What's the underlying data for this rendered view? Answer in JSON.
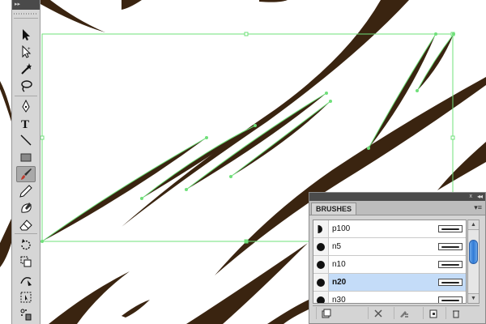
{
  "toolbar": {
    "header_glyph": "▸▸",
    "tools": [
      {
        "name": "selection-tool",
        "icon": "arrow-icon"
      },
      {
        "name": "direct-selection-tool",
        "icon": "hollow-arrow-icon"
      },
      {
        "name": "magic-wand-tool",
        "icon": "magic-wand-icon"
      },
      {
        "name": "lasso-tool",
        "icon": "lasso-icon"
      },
      {
        "name": "pen-tool",
        "icon": "pen-icon"
      },
      {
        "name": "type-tool",
        "icon": "type-icon",
        "glyph": "T"
      },
      {
        "name": "line-tool",
        "icon": "line-icon"
      },
      {
        "name": "rectangle-tool",
        "icon": "rectangle-icon"
      },
      {
        "name": "paintbrush-tool",
        "icon": "paintbrush-icon",
        "active": true
      },
      {
        "name": "pencil-tool",
        "icon": "pencil-icon"
      },
      {
        "name": "blob-brush-tool",
        "icon": "blob-brush-icon"
      },
      {
        "name": "eraser-tool",
        "icon": "eraser-icon"
      },
      {
        "name": "rotate-tool",
        "icon": "rotate-icon"
      },
      {
        "name": "scale-tool",
        "icon": "scale-icon"
      },
      {
        "name": "warp-tool",
        "icon": "warp-icon"
      },
      {
        "name": "free-transform-tool",
        "icon": "free-transform-icon"
      },
      {
        "name": "symbol-sprayer-tool",
        "icon": "symbol-sprayer-icon"
      }
    ]
  },
  "brushes_panel": {
    "tab_label": "BRUSHES",
    "collapse_glyph": "◂◂",
    "close_glyph": "x",
    "menu_glyph": "▾≡",
    "brushes": [
      {
        "name": "p100",
        "thumb": "half-circle",
        "selected": false
      },
      {
        "name": "n5",
        "thumb": "dot",
        "selected": false
      },
      {
        "name": "n10",
        "thumb": "dot",
        "selected": false
      },
      {
        "name": "n20",
        "thumb": "dot",
        "selected": true
      },
      {
        "name": "n30",
        "thumb": "dot",
        "selected": false
      },
      {
        "name": "",
        "thumb": "dot",
        "selected": false
      }
    ],
    "bottom_buttons": [
      "brush-libraries-icon",
      "remove-stroke-icon",
      "stroke-options-icon",
      "new-brush-icon",
      "delete-brush-icon"
    ]
  },
  "colors": {
    "stroke_fill": "#3a2410",
    "selection": "#6fe07a",
    "selected_row": "#c4dcf8"
  }
}
